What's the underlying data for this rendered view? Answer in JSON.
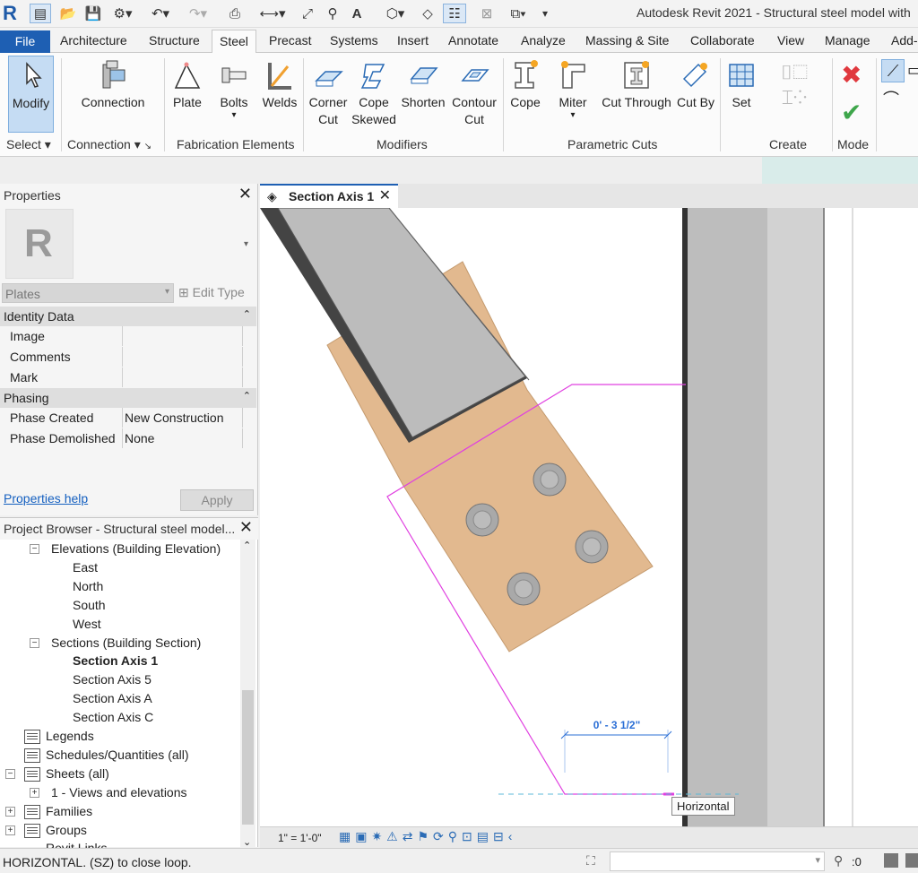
{
  "app": {
    "window_title": "Autodesk Revit 2021 - Structural steel model with"
  },
  "ribbon": {
    "tabs": [
      {
        "label": "File"
      },
      {
        "label": "Architecture"
      },
      {
        "label": "Structure"
      },
      {
        "label": "Steel"
      },
      {
        "label": "Precast"
      },
      {
        "label": "Systems"
      },
      {
        "label": "Insert"
      },
      {
        "label": "Annotate"
      },
      {
        "label": "Analyze"
      },
      {
        "label": "Massing & Site"
      },
      {
        "label": "Collaborate"
      },
      {
        "label": "View"
      },
      {
        "label": "Manage"
      },
      {
        "label": "Add-"
      }
    ],
    "buttons": {
      "modify": "Modify",
      "connection": "Connection",
      "plate": "Plate",
      "bolts": "Bolts",
      "welds": "Welds",
      "corner_cut_1": "Corner",
      "corner_cut_2": "Cut",
      "cope_skewed_1": "Cope",
      "cope_skewed_2": "Skewed",
      "shorten": "Shorten",
      "contour_cut_1": "Contour",
      "contour_cut_2": "Cut",
      "cope": "Cope",
      "miter": "Miter",
      "cut_through": "Cut Through",
      "cut_by": "Cut By",
      "set": "Set"
    },
    "panels": {
      "select": "Select",
      "connection": "Connection",
      "fabrication": "Fabrication Elements",
      "modifiers": "Modifiers",
      "parametric_cuts": "Parametric Cuts",
      "create": "Create",
      "mode": "Mode"
    }
  },
  "properties": {
    "title": "Properties",
    "type_selector": "Plates",
    "edit_type": "Edit Type",
    "groups": [
      {
        "name": "Identity Data",
        "rows": [
          {
            "key": "Image",
            "value": ""
          },
          {
            "key": "Comments",
            "value": ""
          },
          {
            "key": "Mark",
            "value": ""
          }
        ]
      },
      {
        "name": "Phasing",
        "rows": [
          {
            "key": "Phase Created",
            "value": "New Construction"
          },
          {
            "key": "Phase Demolished",
            "value": "None"
          }
        ]
      }
    ],
    "help_link": "Properties help",
    "apply": "Apply"
  },
  "browser": {
    "title": "Project Browser - Structural steel model...",
    "nodes": {
      "elevations": "Elevations (Building Elevation)",
      "east": "East",
      "north": "North",
      "south": "South",
      "west": "West",
      "sections": "Sections (Building Section)",
      "section_axis_1": "Section Axis 1",
      "section_axis_5": "Section Axis 5",
      "section_axis_a": "Section Axis A",
      "section_axis_c": "Section Axis C",
      "legends": "Legends",
      "schedules": "Schedules/Quantities (all)",
      "sheets": "Sheets (all)",
      "sheet_1": "1 - Views and elevations",
      "families": "Families",
      "groups": "Groups",
      "revit_links": "Revit Links"
    }
  },
  "view": {
    "tab_label": "Section Axis 1",
    "dimension": "0' - 3 1/2\"",
    "tooltip": "Horizontal",
    "scale": "1\" = 1'-0\""
  },
  "status": {
    "text": "HORIZONTAL.  (SZ) to close loop.",
    "workset_count": ":0"
  },
  "colors": {
    "accent": "#1e5fb3",
    "plate": "#e2b98f",
    "sketch_line": "#e040e0",
    "dimension": "#2b6fd6"
  }
}
